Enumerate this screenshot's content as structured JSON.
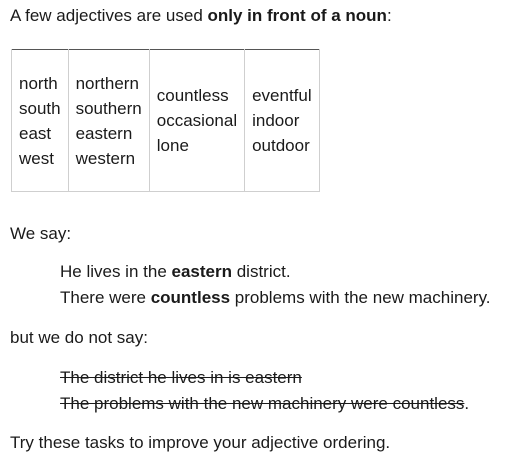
{
  "intro": {
    "prefix": "A few adjectives are used ",
    "emphasis": "only in front of a noun",
    "suffix": ":"
  },
  "adjective_table": {
    "columns": [
      [
        "north",
        "south",
        "east",
        "west"
      ],
      [
        "northern",
        "southern",
        "eastern",
        "western"
      ],
      [
        "countless",
        "occasional",
        "lone"
      ],
      [
        "eventful",
        "indoor",
        "outdoor"
      ]
    ]
  },
  "we_say": "We say:",
  "examples": [
    {
      "before": "He lives in the ",
      "bold": "eastern",
      "after": " district."
    },
    {
      "before": "There were ",
      "bold": "countless",
      "after": " problems with the new machinery."
    }
  ],
  "but_not": "but we do not say:",
  "wrong_examples": [
    {
      "struck": "The district he lives in is eastern",
      "after": ""
    },
    {
      "struck": "The problems with the new machinery were countless",
      "after": "."
    }
  ],
  "closing": "Try these tasks to improve your adjective ordering."
}
